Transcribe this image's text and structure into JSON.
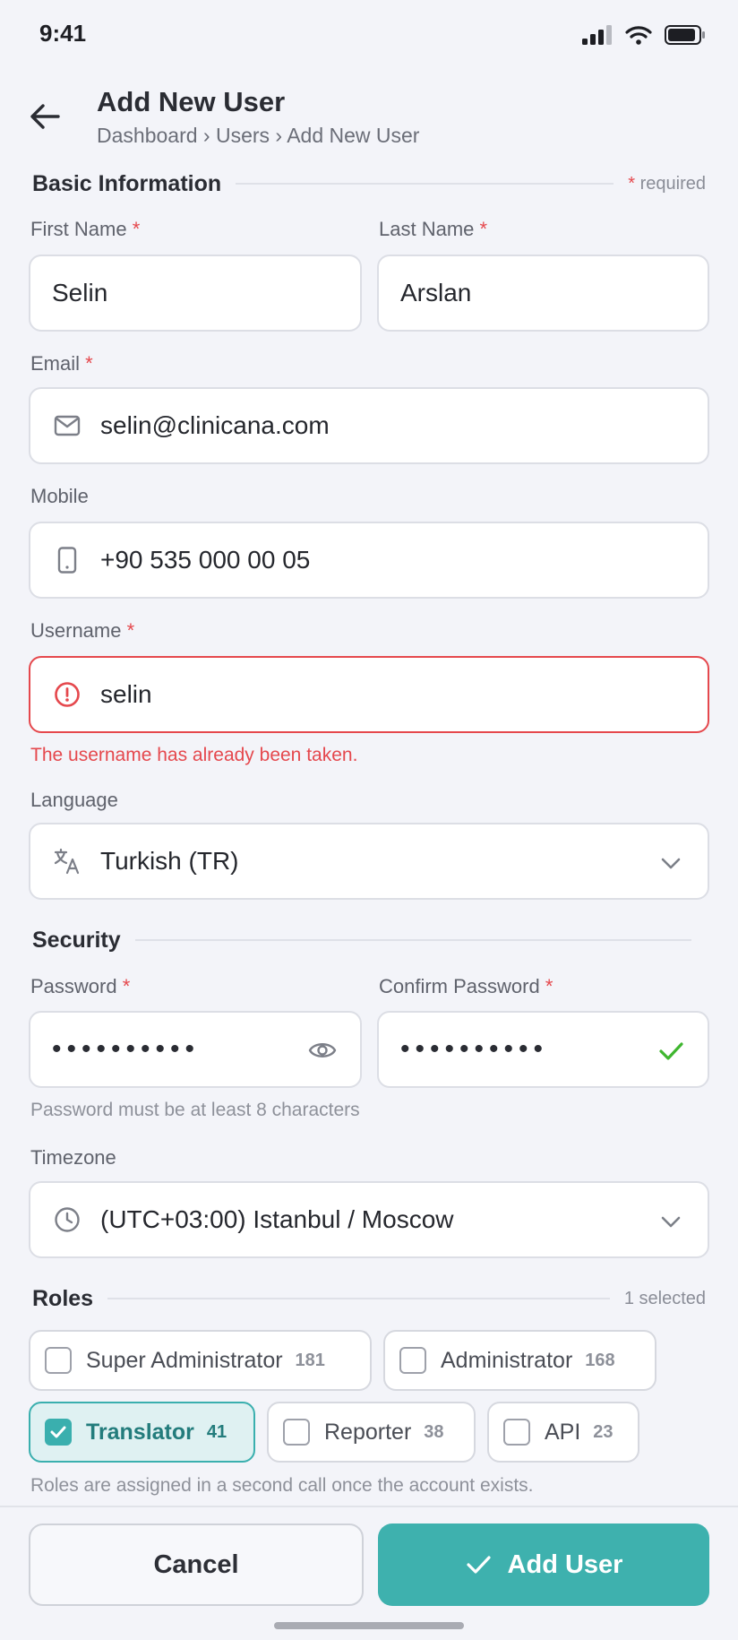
{
  "status_bar": {
    "time": "9:41"
  },
  "header": {
    "title": "Add New User",
    "breadcrumb": "Dashboard › Users › Add New User"
  },
  "basic": {
    "title": "Basic Information",
    "required_star": "*",
    "required_note": "required"
  },
  "form": {
    "first_name": {
      "label": "First Name",
      "star": "*",
      "value": "Selin"
    },
    "last_name": {
      "label": "Last Name",
      "star": "*",
      "value": "Arslan"
    },
    "email": {
      "label": "Email",
      "star": "*",
      "value": "selin@clinicana.com"
    },
    "mobile": {
      "label": "Mobile",
      "value": "+90 535 000 00 05"
    },
    "username": {
      "label": "Username",
      "star": "*",
      "value": "selin",
      "error": "The username has already been taken."
    },
    "language": {
      "label": "Language",
      "value": "Turkish (TR)"
    }
  },
  "security": {
    "title": "Security",
    "password": {
      "label": "Password",
      "star": "*",
      "value": "••••••••••"
    },
    "confirm": {
      "label": "Confirm Password",
      "star": "*",
      "value": "••••••••••"
    },
    "hint": "Password must be at least 8 characters",
    "timezone": {
      "label": "Timezone",
      "value": "(UTC+03:00) Istanbul / Moscow"
    }
  },
  "roles": {
    "title": "Roles",
    "selected_note": "1 selected",
    "items": [
      {
        "label": "Super Administrator",
        "count": "181",
        "selected": false
      },
      {
        "label": "Administrator",
        "count": "168",
        "selected": false
      },
      {
        "label": "Translator",
        "count": "41",
        "selected": true
      },
      {
        "label": "Reporter",
        "count": "38",
        "selected": false
      },
      {
        "label": "API",
        "count": "23",
        "selected": false
      }
    ],
    "note": "Roles are assigned in a second call once the account exists."
  },
  "footer": {
    "cancel": "Cancel",
    "add": "Add User"
  },
  "colors": {
    "accent": "#3eb1ae",
    "error": "#e5484d",
    "success": "#3fb62f"
  }
}
